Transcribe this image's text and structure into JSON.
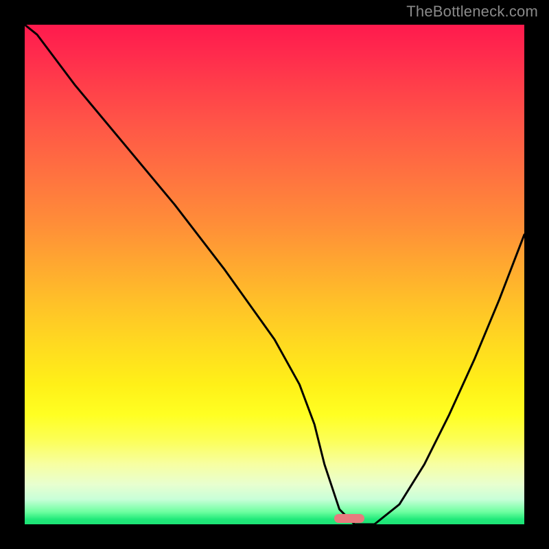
{
  "watermark": "TheBottleneck.com",
  "chart_data": {
    "type": "line",
    "title": "",
    "xlabel": "",
    "ylabel": "",
    "xlim": [
      0,
      100
    ],
    "ylim": [
      0,
      100
    ],
    "grid": false,
    "legend": false,
    "background_gradient": {
      "top": "#ff1a4d",
      "mid": "#ffda20",
      "bottom": "#1de376"
    },
    "series": [
      {
        "name": "bottleneck-curve",
        "color": "#000000",
        "x": [
          0,
          2.5,
          10,
          20,
          30,
          40,
          50,
          55,
          58,
          60,
          63,
          66,
          70,
          75,
          80,
          85,
          90,
          95,
          100
        ],
        "values": [
          100,
          98,
          88,
          76,
          64,
          51,
          37,
          28,
          20,
          12,
          3,
          0,
          0,
          4,
          12,
          22,
          33,
          45,
          58
        ]
      }
    ],
    "markers": [
      {
        "name": "optimal-range",
        "x_center": 65,
        "y": 0,
        "width": 6,
        "color": "#e77b7e"
      }
    ]
  }
}
